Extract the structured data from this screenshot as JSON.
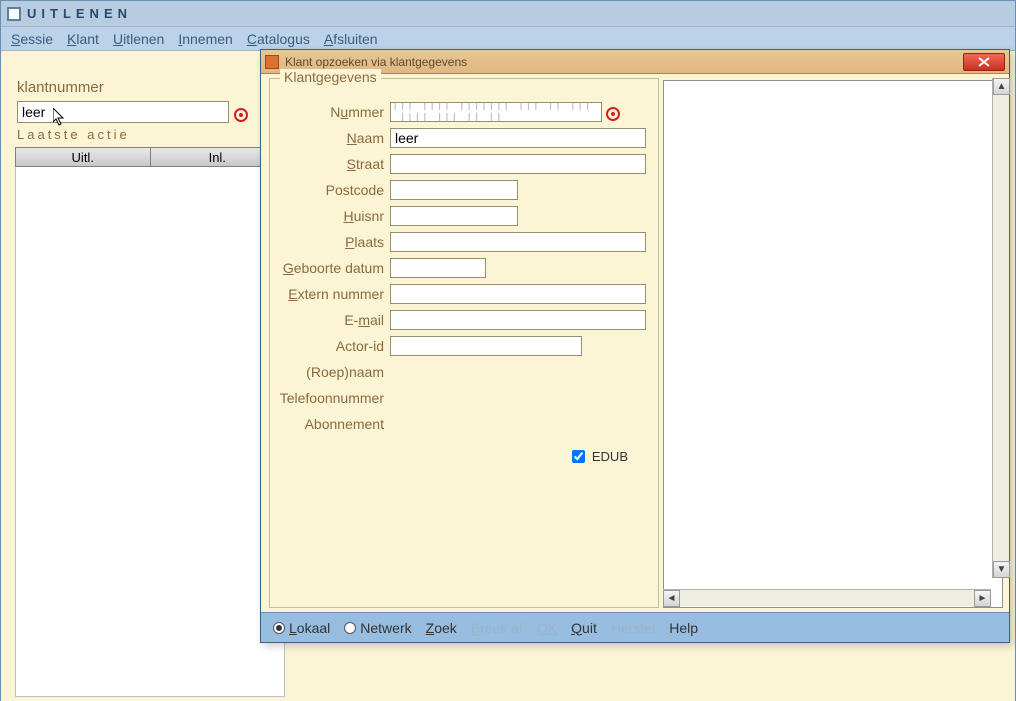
{
  "main": {
    "title": "UITLENEN",
    "menu": [
      "Sessie",
      "Klant",
      "Uitlenen",
      "Innemen",
      "Catalogus",
      "Afsluiten"
    ],
    "menu_hot": [
      "S",
      "K",
      "U",
      "I",
      "C",
      "A"
    ],
    "klant_label": "klantnummer",
    "klant_value": "leer",
    "laatste_actie": "Laatste actie",
    "table_headers": [
      "Uitl.",
      "Inl."
    ]
  },
  "dialog": {
    "title": "Klant opzoeken via klantgegevens",
    "fieldset_title": "Klantgegevens",
    "fields": {
      "nummer": {
        "label": "Nummer",
        "hot": "u",
        "value": ""
      },
      "naam": {
        "label": "Naam",
        "hot": "N",
        "value": "leer"
      },
      "straat": {
        "label": "Straat",
        "hot": "S",
        "value": ""
      },
      "postcode": {
        "label": "Postcode",
        "hot": "",
        "value": ""
      },
      "huisnr": {
        "label": "Huisnr",
        "hot": "H",
        "value": ""
      },
      "plaats": {
        "label": "Plaats",
        "hot": "P",
        "value": ""
      },
      "geboorte": {
        "label": "Geboorte datum",
        "hot": "G",
        "value": ""
      },
      "extern": {
        "label": "Extern nummer",
        "hot": "E",
        "value": ""
      },
      "email": {
        "label": "E-mail",
        "hot": "m",
        "value": ""
      },
      "actorid": {
        "label": "Actor-id",
        "hot": "",
        "value": ""
      },
      "roepnaam": {
        "label": "(Roep)naam",
        "hot": "",
        "value": ""
      },
      "telefoon": {
        "label": "Telefoonnummer",
        "hot": "",
        "value": ""
      },
      "abonnement": {
        "label": "Abonnement",
        "hot": "",
        "value": ""
      }
    },
    "edub_label": "EDUB",
    "edub_checked": true,
    "bottom": {
      "lokaal": "Lokaal",
      "netwerk": "Netwerk",
      "zoek": "Zoek",
      "breekaf": "Breek af",
      "ok": "OK",
      "quit": "Quit",
      "herstel": "Herstel",
      "help": "Help",
      "selected": "lokaal"
    }
  }
}
